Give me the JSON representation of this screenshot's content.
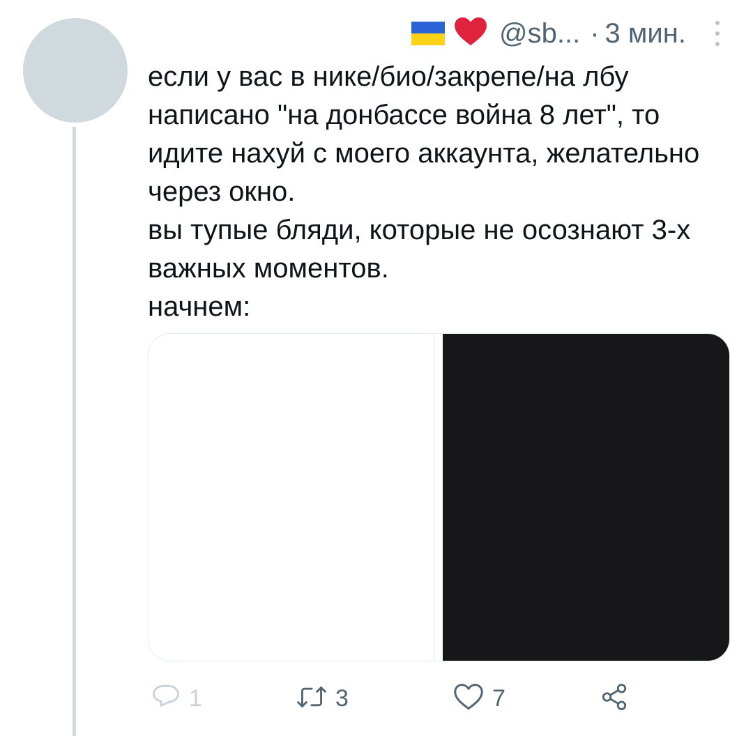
{
  "tweet": {
    "handle": "@sb...",
    "separator": "·",
    "time": "3 мин.",
    "text_lines": [
      "если у вас в нике/био/закрепе/на лбу",
      "написано \"на донбассе война 8 лет\", то",
      "идите нахуй с моего аккаунта, желательно",
      "через окно.",
      "вы тупые бляди, которые не осознают 3-х",
      "важных моментов.",
      "начнем:"
    ],
    "media": {
      "left_color": "#ffffff",
      "right_color": "#171719"
    },
    "actions": {
      "reply_count": "1",
      "retweet_count": "3",
      "like_count": "7"
    }
  },
  "icons": [
    "ukraine-flag-icon",
    "red-heart-icon",
    "more-icon",
    "reply-icon",
    "retweet-icon",
    "like-icon",
    "share-icon"
  ],
  "colors": {
    "text": "#0f1419",
    "secondary": "#536471",
    "avatar": "#cfd9de",
    "heart": "#e0233c"
  }
}
